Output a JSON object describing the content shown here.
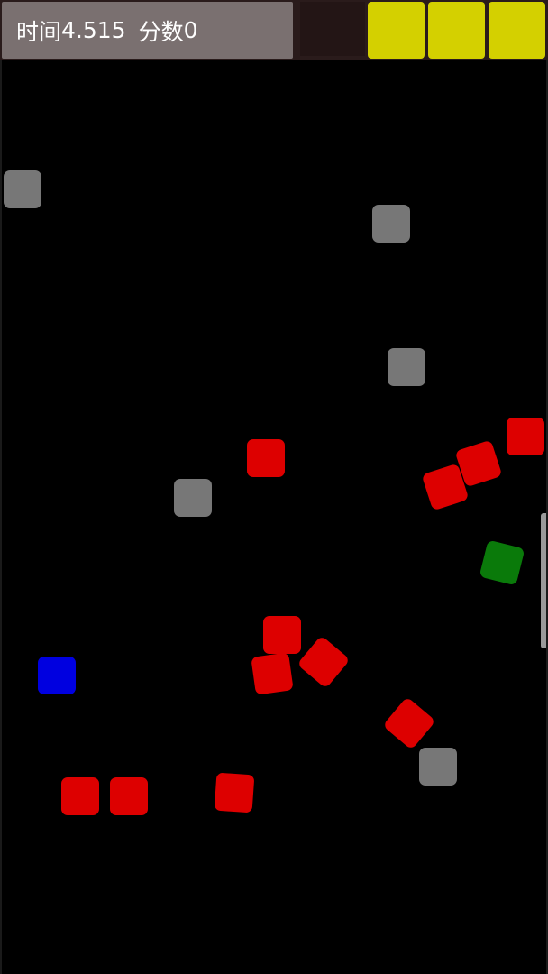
{
  "hud": {
    "time_label": "时间",
    "time_value": "4.515",
    "score_label": "分数",
    "score_value": "0",
    "lives_remaining": 3
  },
  "colors": {
    "hud_panel": "#7a7070",
    "life": "#d4d000",
    "enemy": "#dd0000",
    "obstacle": "#777777",
    "player": "#0000e0",
    "bonus": "#0a7a0a"
  }
}
